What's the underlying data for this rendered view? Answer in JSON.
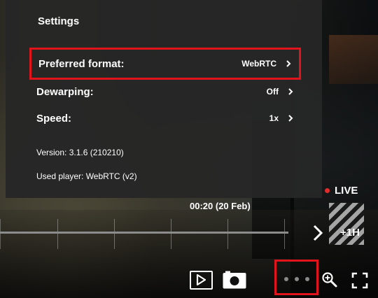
{
  "settings": {
    "title": "Settings",
    "rows": [
      {
        "label": "Preferred format:",
        "value": "WebRTC"
      },
      {
        "label": "Dewarping:",
        "value": "Off"
      },
      {
        "label": "Speed:",
        "value": "1x"
      }
    ],
    "version": "Version: 3.1.6 (210210)",
    "player": "Used player: WebRTC (v2)"
  },
  "player": {
    "live_label": "LIVE",
    "timestamp": "00:20 (20 Feb)",
    "jump_label": "+1H"
  },
  "colors": {
    "highlight": "#e1131b",
    "live_dot": "#e32b2b",
    "panel_bg": "#262626"
  },
  "icons": [
    "chevron-right-icon",
    "play-icon",
    "snapshot-icon",
    "more-dots-icon",
    "zoom-in-icon",
    "fullscreen-icon"
  ]
}
